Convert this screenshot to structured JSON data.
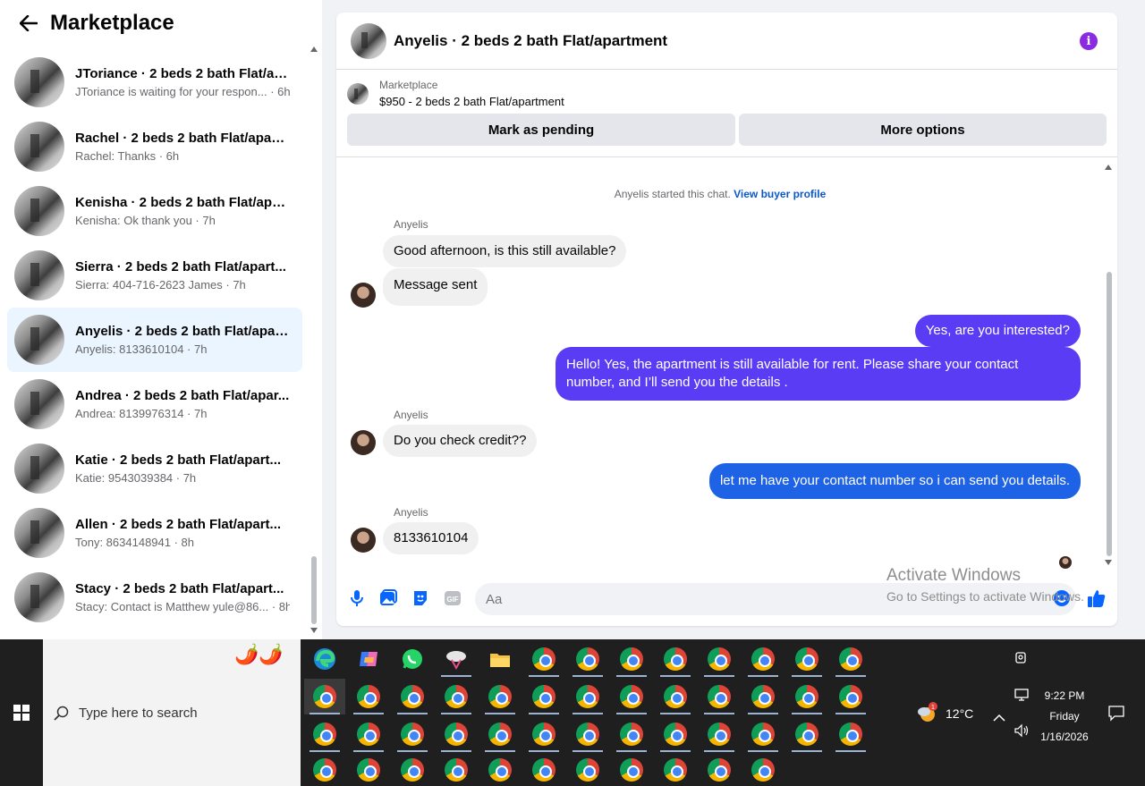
{
  "sidebar": {
    "title": "Marketplace",
    "conversations": [
      {
        "title": "JToriance · 2 beds 2 bath Flat/ap...",
        "sub": "JToriance is waiting for your respon... · 6h"
      },
      {
        "title": "Rachel · 2 beds 2 bath Flat/apart...",
        "sub": "Rachel: Thanks · 6h"
      },
      {
        "title": "Kenisha · 2 beds 2 bath Flat/apa...",
        "sub": "Kenisha: Ok thank you · 7h"
      },
      {
        "title": "Sierra · 2 beds 2 bath Flat/apart...",
        "sub": "Sierra: 404-716-2623 James · 7h"
      },
      {
        "title": "Anyelis · 2 beds 2 bath Flat/apar...",
        "sub": "Anyelis: 8133610104 · 7h"
      },
      {
        "title": "Andrea · 2 beds 2 bath Flat/apar...",
        "sub": "Andrea: 8139976314 · 7h"
      },
      {
        "title": "Katie · 2 beds 2 bath Flat/apart...",
        "sub": "Katie: 9543039384 · 7h"
      },
      {
        "title": "Allen · 2 beds 2 bath Flat/apart...",
        "sub": "Tony: 8634148941 · 8h"
      },
      {
        "title": "Stacy · 2 beds 2 bath Flat/apart...",
        "sub": "Stacy: Contact is Matthew yule@86... · 8h"
      }
    ]
  },
  "chat": {
    "title": "Anyelis · 2 beds 2 bath Flat/apartment",
    "listing_source": "Marketplace",
    "listing_price": "$950 - 2 beds 2 bath Flat/apartment",
    "mark_pending": "Mark as pending",
    "more_options": "More options",
    "started_text": "Anyelis started this chat.",
    "buyer_profile_link": "View buyer profile",
    "sender_name": "Anyelis",
    "messages": {
      "m1": "Good afternoon, is this still available?",
      "m2": "Message sent",
      "m3": "Yes, are you interested?",
      "m4": "Hello! Yes, the apartment is still available for rent. Please share your contact number, and I’ll send you the details .",
      "m5": "Do you check credit??",
      "m6": "let me have your contact number so i can send you details.",
      "m7": "8133610104"
    },
    "composer_placeholder": "Aa",
    "outgoing_color": "#5a3cf5"
  },
  "watermark": {
    "line1": "Activate Windows",
    "line2": "Go to Settings to activate Windows."
  },
  "taskbar": {
    "search_placeholder": "Type here to search",
    "temperature": "12°C",
    "time": "9:22 PM",
    "day": "Friday",
    "date": "1/16/2026",
    "weather_badge": "1"
  }
}
